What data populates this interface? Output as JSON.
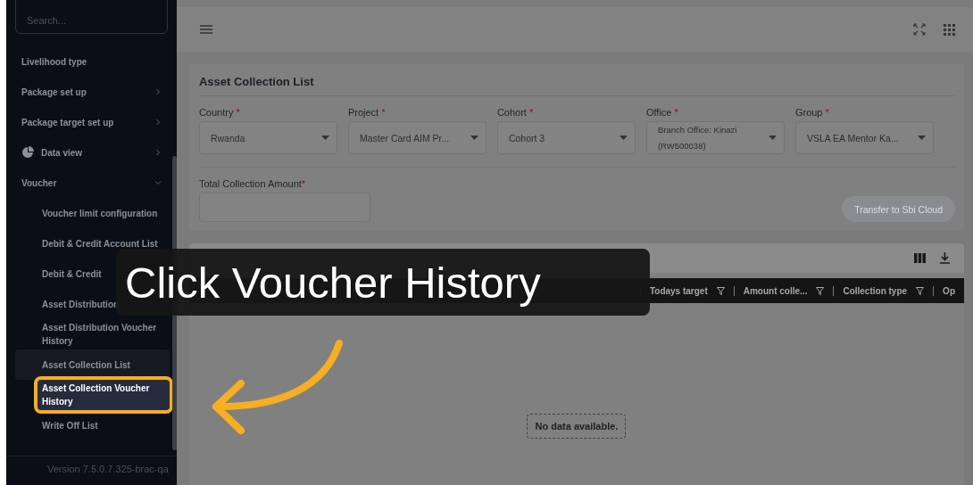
{
  "sidebar": {
    "search": {
      "placeholder": "Search..."
    },
    "items": [
      {
        "label": "Livelihood type"
      },
      {
        "label": "Package set up",
        "expanded": false
      },
      {
        "label": "Package target set up",
        "expanded": false
      },
      {
        "label": "Data view",
        "expanded": false,
        "kind": "pie"
      },
      {
        "label": "Voucher",
        "expanded": true,
        "children": [
          {
            "label": "Voucher limit configuration",
            "selected": false,
            "active": false
          },
          {
            "label": "Debit & Credit Account List",
            "selected": false,
            "active": false
          },
          {
            "label": "Debit & Credit",
            "selected": false,
            "active": false
          },
          {
            "label": "Asset Distribution",
            "selected": false,
            "active": false
          },
          {
            "label": "Asset Distribution Voucher History",
            "selected": false,
            "active": false
          },
          {
            "label": "Asset Collection List",
            "selected": false,
            "active": true
          },
          {
            "label": "Asset Collection Voucher History",
            "selected": true,
            "active": false
          },
          {
            "label": "Write Off List",
            "selected": false,
            "active": false
          }
        ]
      }
    ],
    "version": "Version 7.5.0.7.325-brac-qa"
  },
  "page": {
    "title": "Asset Collection List",
    "filters": [
      {
        "label": "Country",
        "required_mark": "*",
        "value": "Rwanda"
      },
      {
        "label": "Project",
        "required_mark": "*",
        "value": "Master Card AIM Pr..."
      },
      {
        "label": "Cohort",
        "required_mark": "*",
        "value": "Cohort 3"
      },
      {
        "label": "Office",
        "required_mark": "*",
        "value": "Branch Office: Kinazi (RW500038)"
      },
      {
        "label": "Group",
        "required_mark": "*",
        "value": "VSLA EA Mentor Ka..."
      }
    ],
    "amount": {
      "label": "Total Collection Amount",
      "required_mark": "*"
    },
    "transfer_button": {
      "label": "Transfer to Sbi Cloud",
      "disabled": true
    },
    "table": {
      "columns": [
        "Todays target",
        "Amount colle...",
        "Collection type",
        "Op"
      ],
      "empty_text": "No data available."
    }
  },
  "callout": {
    "text": "Click Voucher History"
  }
}
